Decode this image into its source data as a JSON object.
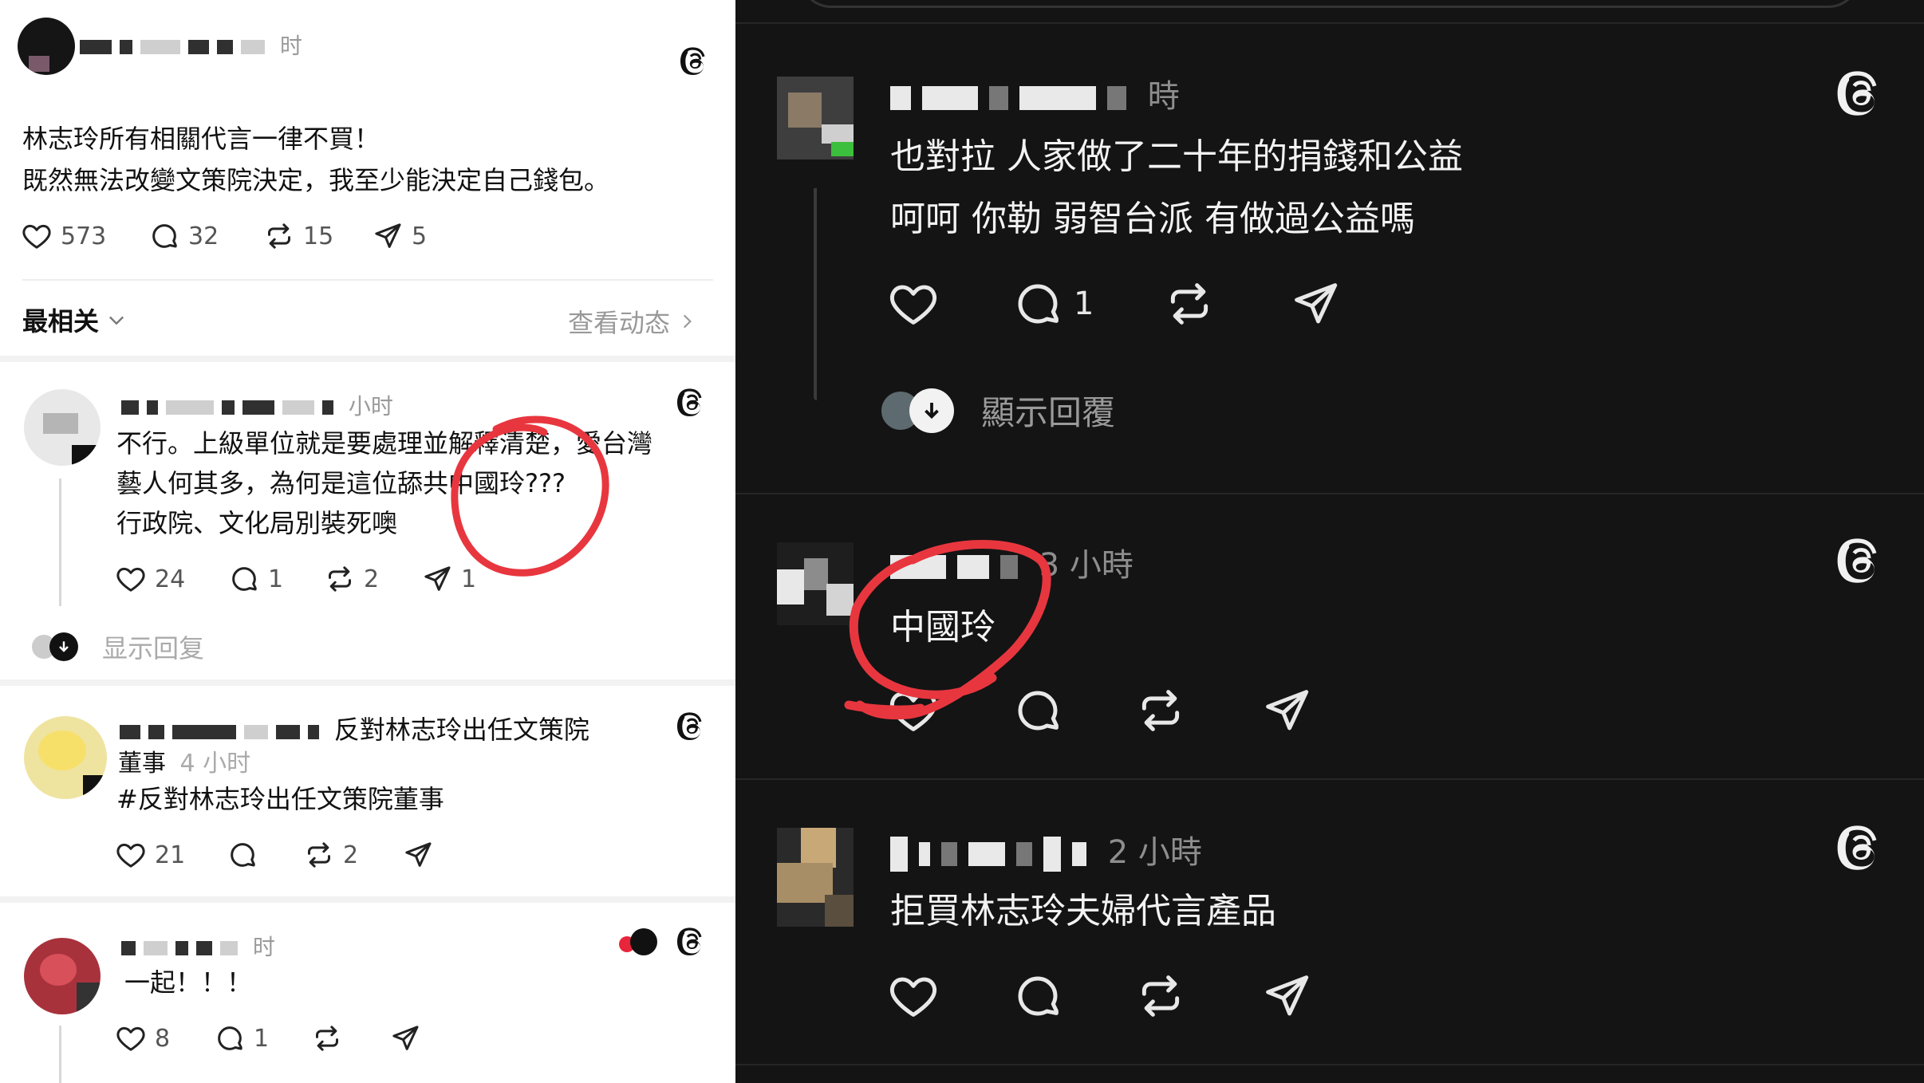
{
  "left_panel": {
    "theme": "light",
    "post": {
      "time": "时",
      "text_line1": "林志玲所有相關代言一律不買！",
      "text_line2": "既然無法改變文策院決定，我至少能決定自己錢包。",
      "likes": "573",
      "comments": "32",
      "reposts": "15",
      "shares": "5"
    },
    "sort_bar": {
      "sort_label": "最相关",
      "activity_label": "查看动态"
    },
    "replies": [
      {
        "time": "小时",
        "line1": "不行。上級單位就是要處理並解釋清楚，愛台灣",
        "line2": "藝人何其多，為何是這位舔共中國玲???",
        "line3": "行政院、文化局別裝死噢",
        "likes": "24",
        "comments": "1",
        "reposts": "2",
        "shares": "1",
        "show_replies": "显示回复"
      },
      {
        "name_suffix": "反對林志玲出任文策院",
        "name_line2": "董事",
        "time": "4 小时",
        "line1": "#反對林志玲出任文策院董事",
        "likes": "21",
        "reposts": "2"
      },
      {
        "time": "时",
        "line1": "一起！！！",
        "likes": "8",
        "comments": "1"
      }
    ]
  },
  "right_panel": {
    "theme": "dark",
    "replies": [
      {
        "time": "時",
        "line1": "也對拉 人家做了二十年的捐錢和公益",
        "line2": "呵呵 你勒 弱智台派 有做過公益嗎",
        "comments": "1",
        "show_replies": "顯示回覆"
      },
      {
        "time": "3 小時",
        "line1": "中國玲"
      },
      {
        "time": "2 小時",
        "line1": "拒買林志玲夫婦代言產品"
      }
    ]
  },
  "colors": {
    "annotation_red": "#e8363f",
    "dark_bg": "#141414",
    "light_bg": "#ffffff"
  },
  "icons": [
    "threads-logo-icon",
    "heart-icon",
    "comment-icon",
    "repost-icon",
    "share-icon",
    "chevron-down-icon",
    "chevron-right-icon",
    "arrow-down-icon"
  ]
}
